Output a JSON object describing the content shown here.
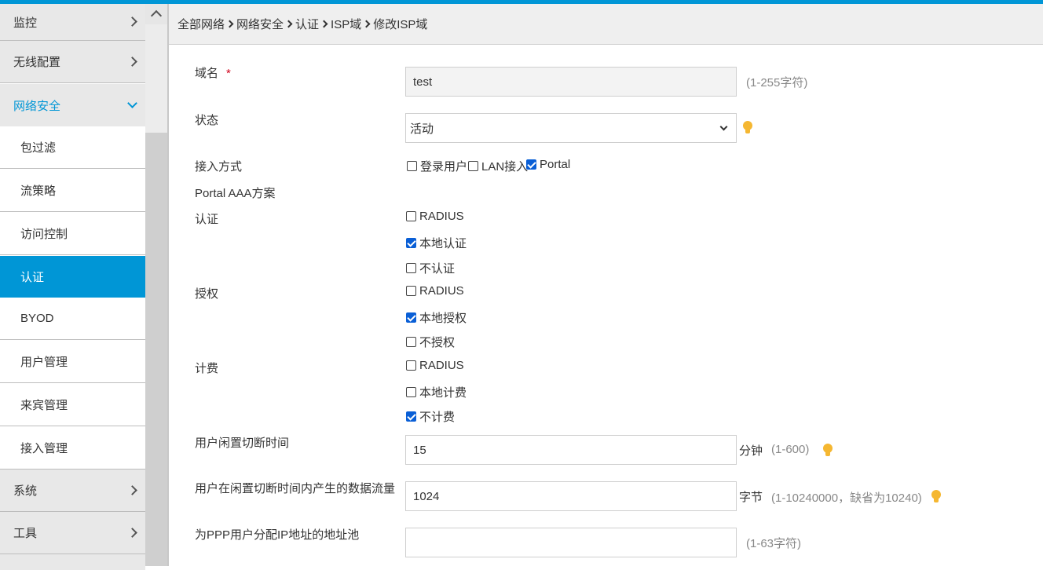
{
  "sidebar": {
    "items": [
      {
        "label": "监控"
      },
      {
        "label": "无线配置"
      },
      {
        "label": "网络安全"
      },
      {
        "label": "包过滤"
      },
      {
        "label": "流策略"
      },
      {
        "label": "访问控制"
      },
      {
        "label": "认证"
      },
      {
        "label": "BYOD"
      },
      {
        "label": "用户管理"
      },
      {
        "label": "来宾管理"
      },
      {
        "label": "接入管理"
      },
      {
        "label": "系统"
      },
      {
        "label": "工具"
      }
    ]
  },
  "breadcrumb": [
    "全部网络",
    "网络安全",
    "认证",
    "ISP域",
    "修改ISP域"
  ],
  "form": {
    "domain": {
      "label": "域名",
      "required": "*",
      "value": "test",
      "hint": "(1-255字符)"
    },
    "status": {
      "label": "状态",
      "value": "活动"
    },
    "access": {
      "label": "接入方式",
      "options": [
        {
          "label": "登录用户",
          "checked": false
        },
        {
          "label": "LAN接入",
          "checked": false
        },
        {
          "label": "Portal",
          "checked": true
        }
      ]
    },
    "aaa_title": "Portal AAA方案",
    "auth": {
      "label": "认证",
      "options": [
        {
          "label": "RADIUS",
          "checked": false
        },
        {
          "label": "本地认证",
          "checked": true
        },
        {
          "label": "不认证",
          "checked": false
        }
      ]
    },
    "authz": {
      "label": "授权",
      "options": [
        {
          "label": "RADIUS",
          "checked": false
        },
        {
          "label": "本地授权",
          "checked": true
        },
        {
          "label": "不授权",
          "checked": false
        }
      ]
    },
    "acct": {
      "label": "计费",
      "options": [
        {
          "label": "RADIUS",
          "checked": false
        },
        {
          "label": "本地计费",
          "checked": false
        },
        {
          "label": "不计费",
          "checked": true
        }
      ]
    },
    "idle_time": {
      "label": "用户闲置切断时间",
      "value": "15",
      "unit": "分钟",
      "hint": "(1-600)"
    },
    "idle_traffic": {
      "label": "用户在闲置切断时间内产生的数据流量",
      "value": "1024",
      "unit": "字节",
      "hint": "(1-10240000，缺省为10240)"
    },
    "ip_pool": {
      "label": "为PPP用户分配IP地址的地址池",
      "value": "",
      "hint": "(1-63字符)"
    }
  },
  "colors": {
    "accent": "#0096d6",
    "checkbox": "#0a5fd6",
    "hint_icon": "#f5b731"
  }
}
